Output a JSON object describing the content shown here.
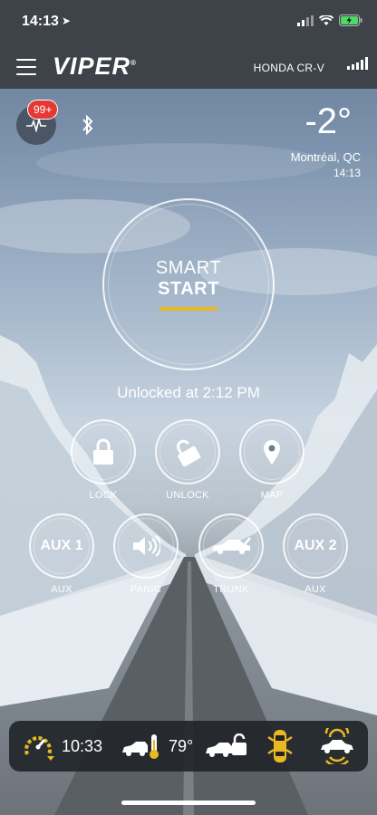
{
  "status_bar": {
    "time": "14:13",
    "location_arrow": "➤"
  },
  "header": {
    "logo": "VIPER",
    "logo_mark": "®",
    "vehicle": "HONDA CR-V"
  },
  "notifications": {
    "badge": "99+"
  },
  "weather": {
    "temperature": "-2°",
    "city": "Montréal, QC",
    "time": "14:13"
  },
  "smart_start": {
    "line1": "SMART",
    "line2": "START",
    "accent_color": "#e8b923"
  },
  "lock_status": "Unlocked at 2:12 PM",
  "controls": {
    "lock": "LOCK",
    "unlock": "UNLOCK",
    "map": "MAP",
    "aux1_icon": "AUX 1",
    "aux1": "AUX",
    "panic": "PANIC",
    "trunk": "TRUNK",
    "aux2_icon": "AUX 2",
    "aux2": "AUX"
  },
  "tray": {
    "runtime": "10:33",
    "cabin_temp": "79°",
    "accent_color": "#e8b923"
  },
  "icons": [
    "menu-icon",
    "signal-icon",
    "activity-icon",
    "bluetooth-icon",
    "lock-icon",
    "unlock-icon",
    "map-pin-icon",
    "speaker-icon",
    "car-trunk-icon",
    "remote-start-timer-icon",
    "car-thermometer-icon",
    "car-lock-icon",
    "car-doors-icon",
    "car-alarm-icon"
  ]
}
